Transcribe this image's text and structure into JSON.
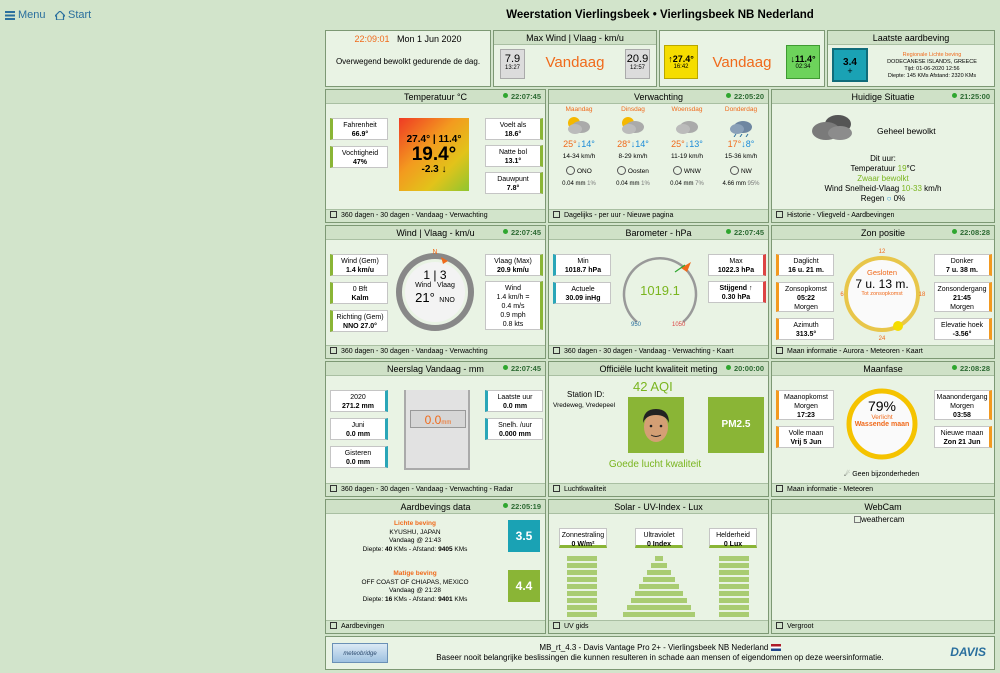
{
  "nav": {
    "menu": "Menu",
    "start": "Start"
  },
  "title": "Weerstation Vierlingsbeek  •  Vierlingsbeek NB Nederland",
  "clock": {
    "time": "22:09:01",
    "date": "Mon 1 Jun 2020",
    "forecast": "Overwegend bewolkt gedurende de dag."
  },
  "maxwind": {
    "title": "Max Wind | Vlaag - km/u",
    "wind_val": "7.9",
    "wind_time": "13:27",
    "label": "Vandaag",
    "gust_val": "20.9",
    "gust_time": "12:57"
  },
  "temptoday": {
    "hi": "↑27.4°",
    "hi_time": "16:42",
    "label": "Vandaag",
    "lo": "↓11.4°",
    "lo_time": "02:34"
  },
  "quake_latest": {
    "title": "Laatste aardbeving",
    "mag": "3.4",
    "plus": "+",
    "cat": "Regionale Lichte beving",
    "place": "DODECANESE ISLANDS, GREECE",
    "time": "Tijd: 01-06-2020 12:56",
    "depth": "Diepte: 145 KMs Afstand: 2320 KMs"
  },
  "temp": {
    "title": "Temperatuur °C",
    "ts": "22:07:45",
    "fahr_l": "Fahrenheit",
    "fahr_v": "66.9°",
    "hum_l": "Vochtigheid",
    "hum_v": "47%",
    "hilo": "27.4° | 11.4°",
    "current": "19.4°",
    "trend": "-2.3 ↓",
    "feels_l": "Voelt als",
    "feels_v": "18.6°",
    "wet_l": "Natte bol",
    "wet_v": "13.1°",
    "dew_l": "Dauwpunt",
    "dew_v": "7.8°",
    "footer": "360 dagen  - 30 dagen  - Vandaag  - Verwachting"
  },
  "forecast": {
    "title": "Verwachting",
    "ts": "22:05:20",
    "days": [
      {
        "name": "Maandag",
        "hi": "25°",
        "lo": "14°",
        "wind": "14-34 km/h",
        "dir": "ONO",
        "rain": "0.04 mm",
        "pct": "1%"
      },
      {
        "name": "Dinsdag",
        "hi": "28°",
        "lo": "14°",
        "wind": "8-29 km/h",
        "dir": "Oosten",
        "rain": "0.04 mm",
        "pct": "1%"
      },
      {
        "name": "Woensdag",
        "hi": "25°",
        "lo": "13°",
        "wind": "11-19 km/h",
        "dir": "WNW",
        "rain": "0.04 mm",
        "pct": "7%"
      },
      {
        "name": "Donderdag",
        "hi": "17°",
        "lo": "8°",
        "wind": "15-36 km/h",
        "dir": "NW",
        "rain": "4.66 mm",
        "pct": "95%"
      }
    ],
    "footer": "Dagelijks  - per uur  -  Nieuwe pagina"
  },
  "current": {
    "title": "Huidige Situatie",
    "ts": "21:25:00",
    "desc": "Geheel bewolkt",
    "now": "Dit uur:",
    "temp_l": "Temperatuur",
    "temp_v": "19",
    "temp_u": "°C",
    "sky": "Zwaar bewolkt",
    "wind_l": "Wind Snelheid-Vlaag",
    "wind_v": "10-33",
    "wind_u": "km/h",
    "rain_l": "Regen",
    "rain_v": "0%",
    "footer": "Historie  - Vliegveld  - Aardbevingen"
  },
  "wind": {
    "title": "Wind | Vlaag - km/u",
    "ts": "22:07:45",
    "avg_l": "Wind (Gem)",
    "avg_v": "1.4 km/u",
    "bft_v": "0 Bft",
    "bft_d": "Kalm",
    "dir_l": "Richting (Gem)",
    "dir_v": "NNO 27.0°",
    "N": "N",
    "speed": "1 | 3",
    "w1": "Wind",
    "w2": "Vlaag",
    "deg": "21°",
    "dirabbr": "NNO",
    "gust_l": "Vlaag (Max)",
    "gust_v": "20.9 km/u",
    "conv_l": "Wind",
    "conv1": "1.4 km/h =",
    "conv2": "0.4 m/s",
    "conv3": "0.9 mph",
    "conv4": "0.8 kts",
    "footer": "360 dagen  - 30 dagen  - Vandaag  - Verwachting"
  },
  "baro": {
    "title": "Barometer - hPa",
    "ts": "22:07:45",
    "min_l": "Min",
    "min_v": "1018.7 hPa",
    "act_l": "Actuele",
    "act_v": "30.09 inHg",
    "value": "1019.1",
    "lo": "950",
    "hi": "1050",
    "max_l": "Max",
    "max_v": "1022.3 hPa",
    "trend_l": "Stijgend ↑",
    "trend_v": "0.30 hPa",
    "footer": "360 dagen  - 30 dagen  - Vandaag  - Verwachting  -  Kaart"
  },
  "sun": {
    "title": "Zon positie",
    "ts": "22:08:28",
    "day_l": "Daglicht",
    "day_v": "16 u. 21 m.",
    "rise_l": "Zonsopkomst",
    "rise_v": "05:22",
    "rise_d": "Morgen",
    "az_l": "Azimuth",
    "az_v": "313.5°",
    "closed": "Gesloten",
    "closed_v": "7 u. 13 m.",
    "closed_s": "Tot zonsopkomst",
    "t12": "12",
    "t18": "18",
    "t24": "24",
    "t6": "6",
    "dark_l": "Donker",
    "dark_v": "7 u. 38 m.",
    "set_l": "Zonsondergang",
    "set_v": "21:45",
    "set_d": "Morgen",
    "elev_l": "Elevatie hoek",
    "elev_v": "-3.56°",
    "footer": "Maan informatie  - Aurora  - Meteoren  -  Kaart"
  },
  "rain": {
    "title": "Neerslag Vandaag - mm",
    "ts": "22:07:45",
    "y_l": "2020",
    "y_v": "271.2 mm",
    "m_l": "Juni",
    "m_v": "0.0 mm",
    "g_l": "Gisteren",
    "g_v": "0.0 mm",
    "today": "0.0",
    "unit": "mm",
    "lh_l": "Laatste uur",
    "lh_v": "0.0 mm",
    "rate_l": "Snelh. /uur",
    "rate_v": "0.000 mm",
    "footer": "360 dagen  - 30 dagen  - Vandaag  - Verwachting  - Radar"
  },
  "air": {
    "title": "Officiële lucht kwaliteit meting",
    "ts": "20:00:00",
    "station": "Station ID:",
    "loc": "Vredeweg, Vredepeel",
    "aqi": "42 AQI",
    "pm": "PM2.5",
    "good": "Goede lucht kwaliteit",
    "footer": "Luchtkwaliteit"
  },
  "moon": {
    "title": "Maanfase",
    "ts": "22:08:28",
    "rise_l": "Maanopkomst",
    "rise_d": "Morgen",
    "rise_v": "17:23",
    "full_l": "Volle maan",
    "full_v": "Vrij 5 Jun",
    "pct": "79%",
    "lit": "Verlicht",
    "phase": "Wassende maan",
    "set_l": "Maanondergang",
    "set_d": "Morgen",
    "set_v": "03:58",
    "new_l": "Nieuwe maan",
    "new_v": "Zon 21 Jun",
    "note": "Geen bijzonderheden",
    "footer": "Maan informatie  - Meteoren"
  },
  "quakes": {
    "title": "Aardbevings data",
    "ts": "22:05:19",
    "q1_cat": "Lichte beving",
    "q1_place": "KYUSHU, JAPAN",
    "q1_time": "Vandaag @ 21:43",
    "q1_d1": "Diepte: ",
    "q1_dv": "40",
    "q1_d2": " KMs - Afstand: ",
    "q1_av": "9405",
    "q1_d3": " KMs",
    "q1_mag": "3.5",
    "q2_cat": "Matige beving",
    "q2_place": "OFF COAST OF CHIAPAS, MEXICO",
    "q2_time": "Vandaag @ 21:28",
    "q2_d1": "Diepte: ",
    "q2_dv": "16",
    "q2_d2": " KMs - Afstand: ",
    "q2_av": "9401",
    "q2_d3": " KMs",
    "q2_mag": "4.4",
    "footer": "Aardbevingen"
  },
  "solar": {
    "title": "Solar - UV-Index - Lux",
    "sol_l": "Zonnestraling",
    "sol_v": "0 W/m²",
    "uv_l": "Ultraviolet",
    "uv_v": "0 Index",
    "lux_l": "Helderheid",
    "lux_v": "0 Lux",
    "footer": "UV gids"
  },
  "webcam": {
    "title": "WebCam",
    "alt": "weathercam",
    "footer": "Vergroot"
  },
  "bottom": {
    "logo": "meteobridge",
    "line1": "MB_rt_4.3   -   Davis Vantage Pro 2+   -   Vierlingsbeek NB Nederland",
    "line2": "Baseer nooit belangrijke beslissingen die kunnen resulteren in schade aan mensen of eigendommen op deze weersinformatie.",
    "davis": "DAVIS"
  },
  "colors": {
    "panel": "#e9f3e4",
    "header": "#cfe1c7",
    "orange": "#f06a1b",
    "green": "#7ab51f",
    "teal": "#2aa6b8",
    "yellow": "#f5dd00"
  }
}
